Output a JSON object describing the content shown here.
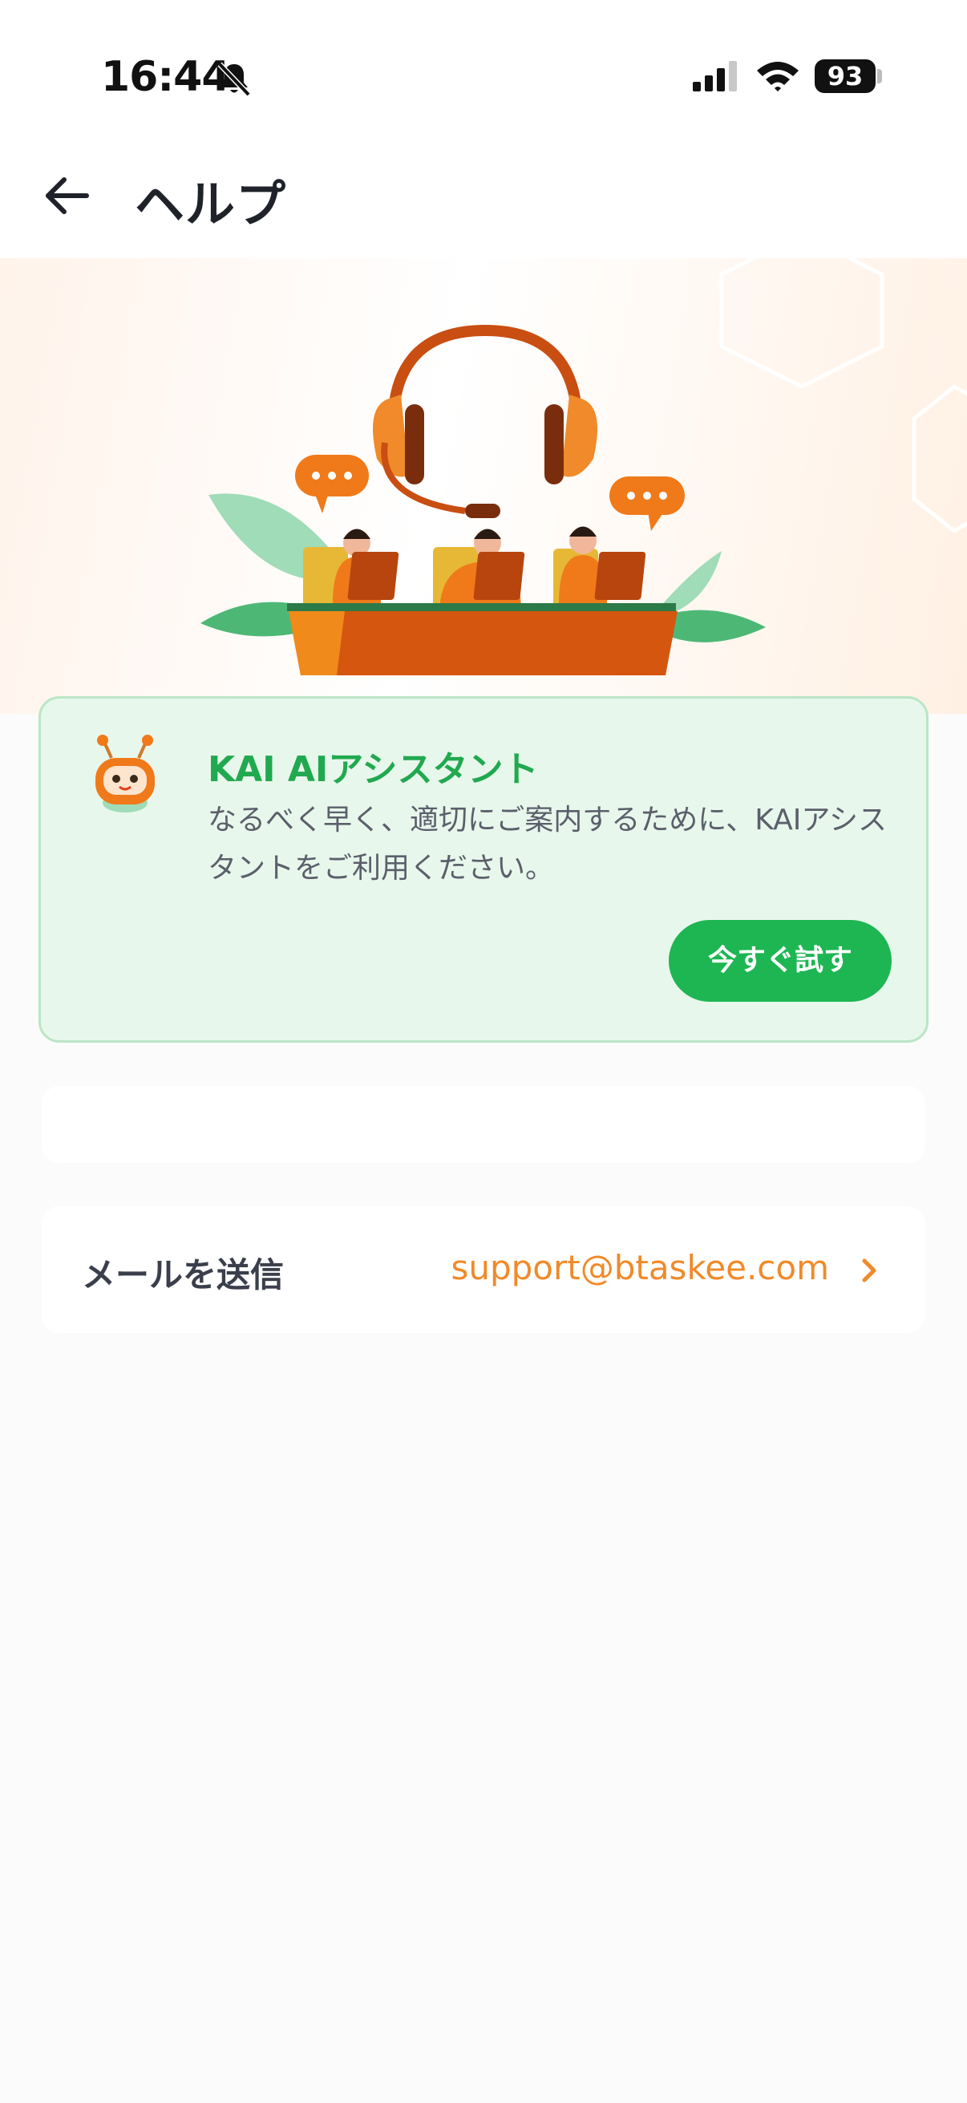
{
  "status_bar": {
    "time": "16:44",
    "battery": "93"
  },
  "header": {
    "title": "ヘルプ"
  },
  "kai_card": {
    "title": "KAI AIアシスタント",
    "description": "なるべく早く、適切にご案内するために、KAIアシスタントをご利用ください。",
    "button_label": "今すぐ試す"
  },
  "email_row": {
    "label": "メールを送信",
    "value": "support@btaskee.com"
  },
  "colors": {
    "accent_green": "#1db652",
    "accent_orange": "#f08a2a",
    "card_green_bg": "#e8f7ec"
  },
  "icons": [
    "bell-slash-icon",
    "signal-icon",
    "wifi-icon",
    "battery-icon",
    "back-arrow-icon",
    "kai-robot-icon",
    "chevron-right-icon"
  ]
}
